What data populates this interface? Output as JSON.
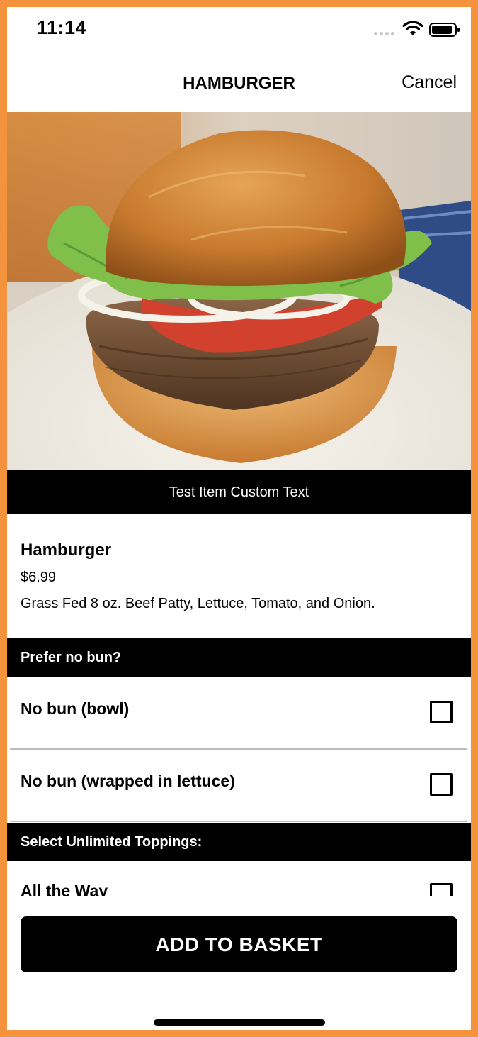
{
  "status_bar": {
    "time": "11:14"
  },
  "nav": {
    "title": "HAMBURGER",
    "cancel_label": "Cancel"
  },
  "hero": {
    "caption": "Test Item Custom Text"
  },
  "item": {
    "name": "Hamburger",
    "price": "$6.99",
    "description": "Grass Fed 8 oz. Beef Patty, Lettuce, Tomato, and Onion."
  },
  "sections": [
    {
      "title": "Prefer no bun?",
      "options": [
        {
          "label": "No bun (bowl)",
          "checked": false
        },
        {
          "label": "No bun (wrapped in lettuce)",
          "checked": false
        }
      ]
    },
    {
      "title": "Select Unlimited Toppings:",
      "options": [
        {
          "label": "All the Way",
          "checked": false
        }
      ]
    }
  ],
  "footer": {
    "add_button_label": "ADD TO BASKET"
  },
  "colors": {
    "frame": "#F5923E",
    "bar": "#000000",
    "background": "#FFFFFF"
  }
}
